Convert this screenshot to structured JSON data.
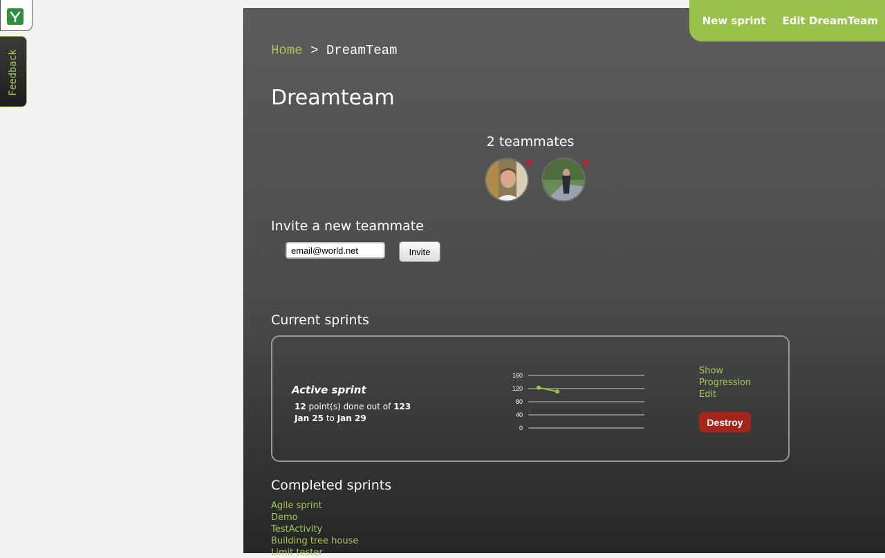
{
  "breadcrumb": {
    "home": "Home",
    "separator": ">",
    "current": "DreamTeam"
  },
  "header_actions": {
    "new_sprint": "New sprint",
    "edit_team": "Edit DreamTeam"
  },
  "feedback_tab": "Feedback",
  "team": {
    "title": "Dreamteam",
    "teammates_label": "2 teammates",
    "remove_mark": "✖"
  },
  "invite": {
    "title": "Invite a new teammate",
    "email_value": "email@world.net",
    "button": "Invite"
  },
  "current_sprints": {
    "title": "Current sprints",
    "sprint": {
      "name": "Active sprint",
      "done_points": "12",
      "done_mid": "point(s) done out of",
      "total_points": "123",
      "start": "Jan 25",
      "to": "to",
      "end": "Jan 29",
      "show": "Show",
      "progression": "Progression",
      "edit": "Edit",
      "destroy": "Destroy"
    }
  },
  "chart_data": {
    "type": "line",
    "y_ticks": [
      "160",
      "120",
      "80",
      "40",
      "0"
    ],
    "ylim": [
      0,
      160
    ],
    "x": [
      1,
      2
    ],
    "series": [
      {
        "values": [
          123,
          111
        ]
      }
    ],
    "color": "#99c24a"
  },
  "completed_sprints": {
    "title": "Completed sprints",
    "items": [
      "Agile sprint",
      "Demo",
      "TestActivity",
      "Building tree house",
      "Limit tester"
    ]
  },
  "colors": {
    "accent": "#99c24a",
    "link": "#a4c95a",
    "danger": "#a3251c"
  }
}
